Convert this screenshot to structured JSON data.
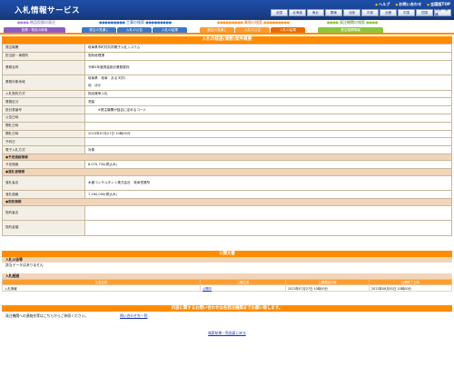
{
  "header": {
    "title": "入札情報サービス",
    "links": [
      "ヘルプ",
      "お問い合わせ",
      "全国版TOP"
    ],
    "regions": [
      "全国",
      "北海道",
      "東北",
      "関東",
      "北陸",
      "中部",
      "近畿",
      "中国",
      "四国",
      "九州・沖縄"
    ]
  },
  "categories": [
    {
      "heading": "物品役務の発注",
      "tabs": [
        "役務・物品の検索"
      ]
    },
    {
      "heading": "工事の検索",
      "tabs": [
        "発注の見通し",
        "入札の公告",
        "入札の結果"
      ]
    },
    {
      "heading": "業務の検索",
      "tabs": [
        "発注の見通し",
        "入札の公告",
        "入札の結果"
      ]
    },
    {
      "heading": "発注機関の検索",
      "tabs": [
        "発注機関情報"
      ]
    }
  ],
  "detail": {
    "title": "入札の経過(業務)案件概要",
    "rows": [
      {
        "label": "発注機関",
        "value": "岐阜県市町村共同電子入札システム"
      },
      {
        "label": "担当部・事務所",
        "value": "契約総理課"
      },
      {
        "label": "業務名称",
        "value": "令和5年度測量設計業務委託"
      },
      {
        "label": "業務対象地域",
        "value": "岐阜県　岐阜　ある 町内",
        "extra": "地　ほか"
      },
      {
        "label": "入札契約方式",
        "value": "指名競争入札"
      },
      {
        "label": "業務区分",
        "value": "測量"
      },
      {
        "label": "設計書番号",
        "value": "　　　※発注機関が独自に定めるコード"
      },
      {
        "label": "公告日時",
        "value": ""
      },
      {
        "label": "開札日時",
        "value": ""
      },
      {
        "label": "開札日時",
        "value": "2023年07月27日 10時00分"
      },
      {
        "label": "予約日",
        "value": ""
      },
      {
        "label": "電子入札方式",
        "value": "対象"
      }
    ],
    "groups": [
      {
        "heading": "●予定価格情報",
        "rows": [
          {
            "label": "予定価格",
            "value": "8,070,700(税込み)"
          }
        ]
      },
      {
        "heading": "●落札者情報",
        "rows": [
          {
            "label": "落札者名",
            "value": "木曽コンサルタント株式会社　岐阜営業所"
          },
          {
            "label": "落札価格",
            "value": "7,260,000(税込み)"
          }
        ]
      },
      {
        "heading": "●契約情報",
        "rows": [
          {
            "label": "契約者名",
            "value": ""
          },
          {
            "label": "契約金額",
            "value": ""
          }
        ]
      }
    ]
  },
  "documents": {
    "title": "公開文書",
    "notice_heading": "入札公告等",
    "notice_text": "該当データはありません",
    "progress_heading": "入札経過",
    "columns": [
      "文書名称",
      "公開文書",
      "公開開始日時",
      "公開終了日時"
    ],
    "rows": [
      {
        "name": "入札情報",
        "doc": "公開中",
        "start": "2023年07月27日 10時00分",
        "end": "2023年08月01日 10時00分"
      }
    ]
  },
  "faq": {
    "title": "内容に関するお問い合わせは各発注機関までお願い致します。",
    "text": "発注機関への連絡先等はこちらからご参照ください。",
    "link": "問い合わせ先一覧"
  },
  "back_link": "検索結果一覧画面に戻る",
  "colors": {
    "accent": "#ff8c00",
    "header": "#1a3f8c"
  }
}
